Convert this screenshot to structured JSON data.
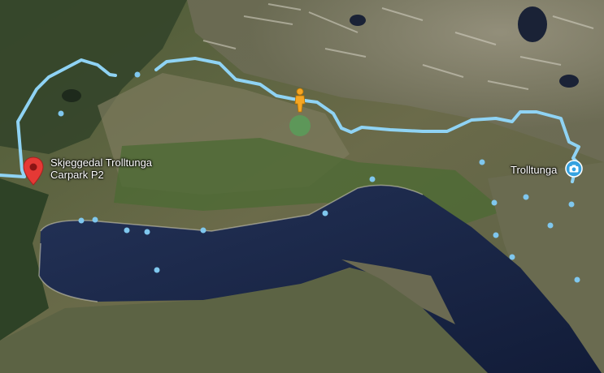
{
  "map": {
    "type": "satellite",
    "route_color": "#8fd3f4",
    "water_color": "#1c2a4a",
    "places": [
      {
        "id": "carpark",
        "name_line1": "Skjeggedal Trolltunga",
        "name_line2": "Carpark P2",
        "marker": "red-pin-icon"
      },
      {
        "id": "trolltunga",
        "name": "Trolltunga",
        "marker": "camera-icon"
      }
    ],
    "pegman_color": "#f5a623",
    "marker_red": "#e53935",
    "camera_marker_color": "#35a2e0"
  }
}
